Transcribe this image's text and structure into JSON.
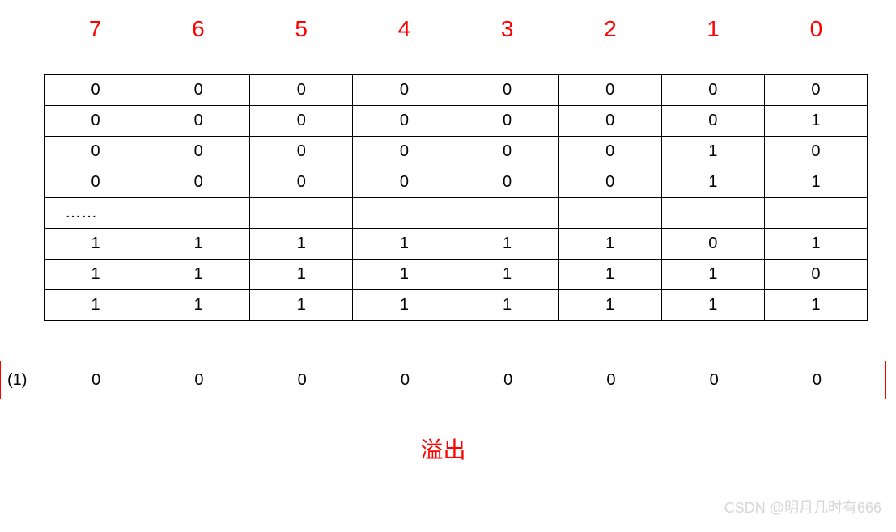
{
  "headers": [
    "7",
    "6",
    "5",
    "4",
    "3",
    "2",
    "1",
    "0"
  ],
  "rows": [
    [
      "0",
      "0",
      "0",
      "0",
      "0",
      "0",
      "0",
      "0"
    ],
    [
      "0",
      "0",
      "0",
      "0",
      "0",
      "0",
      "0",
      "1"
    ],
    [
      "0",
      "0",
      "0",
      "0",
      "0",
      "0",
      "1",
      "0"
    ],
    [
      "0",
      "0",
      "0",
      "0",
      "0",
      "0",
      "1",
      "1"
    ],
    [
      "……",
      "",
      "",
      "",
      "",
      "",
      "",
      ""
    ],
    [
      "1",
      "1",
      "1",
      "1",
      "1",
      "1",
      "0",
      "1"
    ],
    [
      "1",
      "1",
      "1",
      "1",
      "1",
      "1",
      "1",
      "0"
    ],
    [
      "1",
      "1",
      "1",
      "1",
      "1",
      "1",
      "1",
      "1"
    ]
  ],
  "overflow": {
    "prefix": "(1)",
    "cells": [
      "0",
      "0",
      "0",
      "0",
      "0",
      "0",
      "0",
      "0"
    ],
    "caption": "溢出"
  },
  "watermark": "CSDN @明月几时有666",
  "chart_data": {
    "type": "table",
    "title": "8-bit binary counter overflow illustration",
    "columns": [
      "bit7",
      "bit6",
      "bit5",
      "bit4",
      "bit3",
      "bit2",
      "bit1",
      "bit0"
    ],
    "data_rows": [
      [
        0,
        0,
        0,
        0,
        0,
        0,
        0,
        0
      ],
      [
        0,
        0,
        0,
        0,
        0,
        0,
        0,
        1
      ],
      [
        0,
        0,
        0,
        0,
        0,
        0,
        1,
        0
      ],
      [
        0,
        0,
        0,
        0,
        0,
        0,
        1,
        1
      ],
      "ellipsis",
      [
        1,
        1,
        1,
        1,
        1,
        1,
        0,
        1
      ],
      [
        1,
        1,
        1,
        1,
        1,
        1,
        1,
        0
      ],
      [
        1,
        1,
        1,
        1,
        1,
        1,
        1,
        1
      ]
    ],
    "overflow_row": {
      "carry_out": 1,
      "bits": [
        0,
        0,
        0,
        0,
        0,
        0,
        0,
        0
      ]
    },
    "overflow_label": "溢出"
  }
}
